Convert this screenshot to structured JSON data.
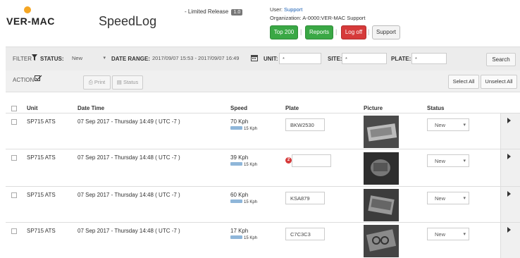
{
  "header": {
    "logo_text": "VER-MAC",
    "app_title": "SpeedLog",
    "release_text": "- Limited Release",
    "release_version": "1.0",
    "user_label": "User:",
    "user_name": "Support",
    "org_label": "Organization:",
    "org_value": "A-0000:VER-MAC Support",
    "buttons": {
      "top200": "Top 200",
      "reports": "Reports",
      "logoff": "Log off",
      "support": "Support"
    },
    "separator": "|"
  },
  "filters": {
    "filter_label": "FILTER",
    "status_label": "STATUS:",
    "status_value": "New",
    "date_range_label": "DATE RANGE:",
    "date_range_value": "2017/09/07 15:53 - 2017/09/07 16:49",
    "unit_label": "UNIT:",
    "unit_value": "*",
    "site_label": "SITE:",
    "site_value": "*",
    "plate_label": "PLATE:",
    "plate_value": "*",
    "search_button": "Search"
  },
  "actions": {
    "action_label": "ACTION",
    "print_button": "Print",
    "status_button": "Status",
    "select_all_button": "Select All",
    "unselect_all_button": "Unselect All"
  },
  "table": {
    "columns": [
      "Unit",
      "Date Time",
      "Speed",
      "Plate",
      "Picture",
      "Status"
    ],
    "rows": [
      {
        "unit": "SP715 ATS",
        "datetime": "07 Sep 2017 - Thursday 14:49 ( UTC -7 )",
        "speed": "70 Kph",
        "limit": "15 Kph",
        "plate": "BKW2530",
        "plate_error": "",
        "status": "New"
      },
      {
        "unit": "SP715 ATS",
        "datetime": "07 Sep 2017 - Thursday 14:48 ( UTC -7 )",
        "speed": "39 Kph",
        "limit": "15 Kph",
        "plate": "",
        "plate_error": "2",
        "status": "New"
      },
      {
        "unit": "SP715 ATS",
        "datetime": "07 Sep 2017 - Thursday 14:48 ( UTC -7 )",
        "speed": "60 Kph",
        "limit": "15 Kph",
        "plate": "KSA879",
        "plate_error": "",
        "status": "New"
      },
      {
        "unit": "SP715 ATS",
        "datetime": "07 Sep 2017 - Thursday 14:48 ( UTC -7 )",
        "speed": "17 Kph",
        "limit": "15 Kph",
        "plate": "C7C3C3",
        "plate_error": "",
        "status": "New"
      }
    ]
  },
  "icons": {
    "logo": "sun-logo-icon",
    "filter": "filter-icon",
    "calendar": "calendar-icon",
    "action": "checkbox-edit-icon",
    "print": "printer-icon",
    "status": "document-icon",
    "row_expand": "triangle-right-icon",
    "caret": "caret-down-icon"
  },
  "colors": {
    "green": "#3aa845",
    "red": "#d63a3a",
    "logo_sun": "#f5a623",
    "link": "#1a5fb4"
  }
}
